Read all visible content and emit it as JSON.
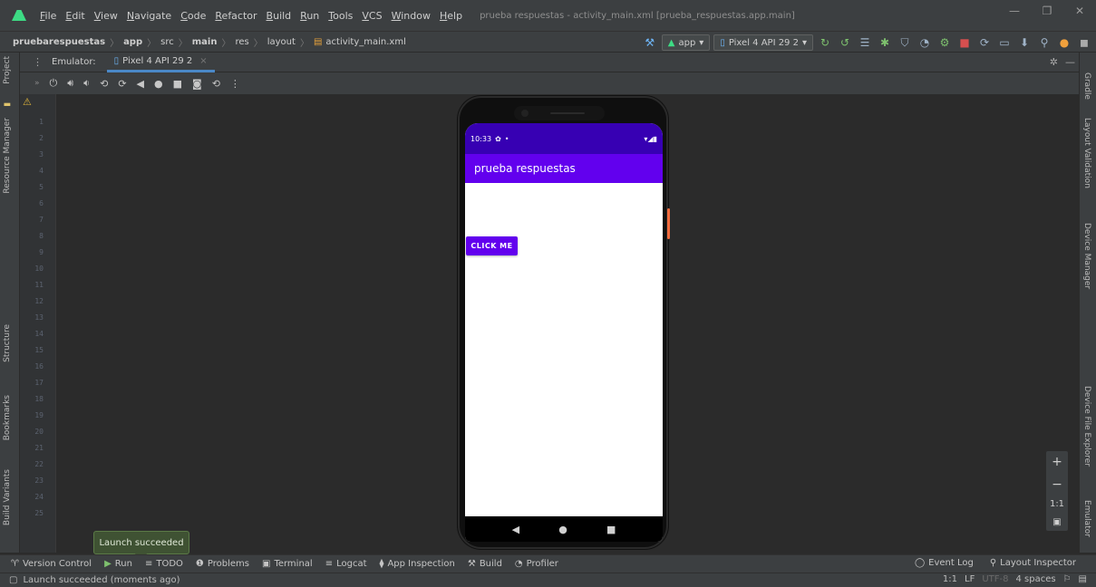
{
  "menubar": {
    "items": [
      "File",
      "Edit",
      "View",
      "Navigate",
      "Code",
      "Refactor",
      "Build",
      "Run",
      "Tools",
      "VCS",
      "Window",
      "Help"
    ],
    "window_title": "prueba respuestas - activity_main.xml [prueba_respuestas.app.main]"
  },
  "breadcrumb": {
    "items": [
      "pruebarespuestas",
      "app",
      "src",
      "main",
      "res",
      "layout",
      "activity_main.xml"
    ]
  },
  "toolbar": {
    "run_config": "app",
    "device": "Pixel 4 API 29 2"
  },
  "emulator_tabs": {
    "label": "Emulator:",
    "tab": "Pixel 4 API 29 2"
  },
  "left_tabs": {
    "project": "Project",
    "resource_manager": "Resource Manager",
    "structure": "Structure",
    "bookmarks": "Bookmarks",
    "build_variants": "Build Variants"
  },
  "right_tabs": {
    "gradle": "Gradle",
    "layout_validation": "Layout Validation",
    "device_manager": "Device Manager",
    "device_file_explorer": "Device File Explorer",
    "emulator": "Emulator"
  },
  "gutter": {
    "line_numbers": [
      "1",
      "2",
      "3",
      "4",
      "5",
      "6",
      "7",
      "8",
      "9",
      "10",
      "11",
      "12",
      "13",
      "14",
      "15",
      "16",
      "17",
      "18",
      "19",
      "20",
      "21",
      "22",
      "23",
      "24",
      "25"
    ]
  },
  "phone": {
    "time": "10:33",
    "app_title": "prueba respuestas",
    "button_label": "CLICK ME",
    "status_icons": "▾◢▮"
  },
  "zoom": {
    "plus": "+",
    "minus": "−",
    "one_to_one": "1:1"
  },
  "toast": {
    "text": "Launch succeeded"
  },
  "bottom_tools": {
    "version_control": "Version Control",
    "run": "Run",
    "todo": "TODO",
    "problems": "Problems",
    "terminal": "Terminal",
    "logcat": "Logcat",
    "app_inspection": "App Inspection",
    "build": "Build",
    "profiler": "Profiler",
    "event_log": "Event Log",
    "layout_inspector": "Layout Inspector"
  },
  "statusline": {
    "message": "Launch succeeded (moments ago)",
    "position": "1:1",
    "line_sep": "LF",
    "encoding": "UTF-8",
    "indent": "4 spaces"
  },
  "colors": {
    "status_bar": "#3700b3",
    "app_bar": "#6200ee",
    "button": "#6200ee",
    "ide_bg": "#2b2b2b",
    "ide_panel": "#3c3f41"
  }
}
